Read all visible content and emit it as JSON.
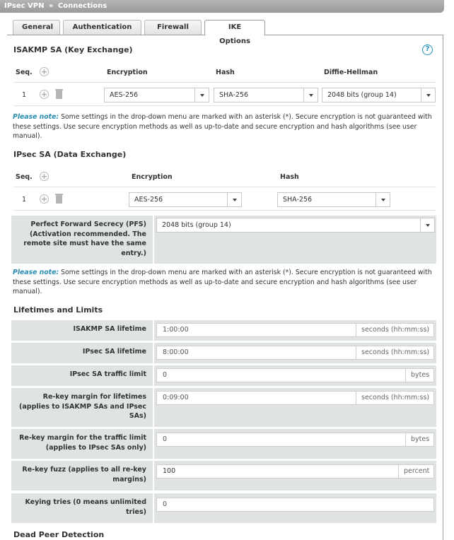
{
  "breadcrumb": {
    "part1": "IPsec VPN",
    "separator": "»",
    "part2": "Connections"
  },
  "tabs": [
    {
      "label": "General",
      "active": false
    },
    {
      "label": "Authentication",
      "active": false
    },
    {
      "label": "Firewall",
      "active": false
    },
    {
      "label": "IKE Options",
      "active": true
    }
  ],
  "isakmp": {
    "title": "ISAKMP SA (Key Exchange)",
    "help_label": "?",
    "headers": {
      "seq": "Seq.",
      "encryption": "Encryption",
      "hash": "Hash",
      "dh": "Diffie-Hellman"
    },
    "row": {
      "seq": "1",
      "encryption": "AES-256",
      "hash": "SHA-256",
      "dh": "2048 bits (group 14)"
    }
  },
  "note": {
    "prefix": "Please note:",
    "line1": " Some settings in the drop-down menu are marked with an asterisk (*). Secure encryption is not guaranteed with",
    "line2": "these settings. Use secure encryption methods as well as up-to-date and secure encryption and hash algorithms (see user",
    "line3": "manual)."
  },
  "ipsec": {
    "title": "IPsec SA (Data Exchange)",
    "headers": {
      "seq": "Seq.",
      "encryption": "Encryption",
      "hash": "Hash"
    },
    "row": {
      "seq": "1",
      "encryption": "AES-256",
      "hash": "SHA-256"
    },
    "pfs": {
      "label_lines": [
        "Perfect Forward Secrecy (PFS)",
        "(Activation recommended. The",
        "remote site must have the same",
        "entry.)"
      ],
      "value": "2048 bits (group 14)"
    }
  },
  "lifetimes": {
    "title": "Lifetimes and Limits",
    "rows": [
      {
        "label_lines": [
          "ISAKMP SA lifetime"
        ],
        "value": "1:00:00",
        "unit": "seconds (hh:mm:ss)"
      },
      {
        "label_lines": [
          "IPsec SA lifetime"
        ],
        "value": "8:00:00",
        "unit": "seconds (hh:mm:ss)"
      },
      {
        "label_lines": [
          "IPsec SA traffic limit"
        ],
        "value": "0",
        "unit": "bytes"
      },
      {
        "label_lines": [
          "Re-key margin for lifetimes",
          "(applies to ISAKMP SAs and IPsec",
          "SAs)"
        ],
        "value": "0:09:00",
        "unit": "seconds (hh:mm:ss)"
      },
      {
        "label_lines": [
          "Re-key margin for the traffic limit",
          "(applies to IPsec SAs only)"
        ],
        "value": "0",
        "unit": "bytes"
      },
      {
        "label_lines": [
          "Re-key fuzz (applies to all re-key",
          "margins)"
        ],
        "value": "100",
        "unit": "percent"
      },
      {
        "label_lines": [
          "Keying tries (0 means unlimited",
          "tries)"
        ],
        "value": "0",
        "unit": ""
      }
    ]
  },
  "dpd": {
    "title": "Dead Peer Detection"
  }
}
